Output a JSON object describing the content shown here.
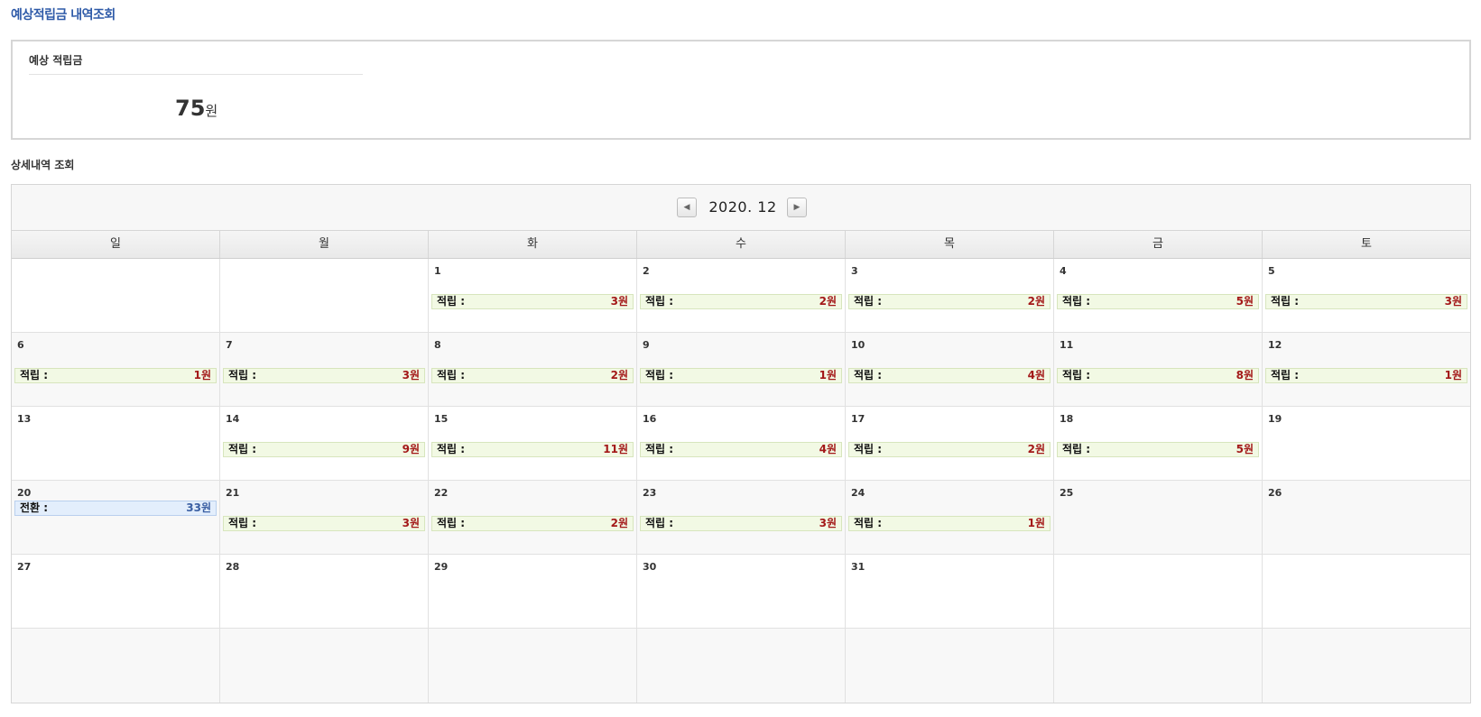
{
  "page": {
    "title": "예상적립금 내역조회"
  },
  "summary": {
    "label": "예상 적립금",
    "amount": "75",
    "unit": "원"
  },
  "details": {
    "title": "상세내역 조회"
  },
  "calendar": {
    "month_label": "2020. 12",
    "prev_icon": "triangle-left-icon",
    "next_icon": "triangle-right-icon",
    "weekdays": [
      "일",
      "월",
      "화",
      "수",
      "목",
      "금",
      "토"
    ],
    "weeks": [
      [
        {
          "day": "",
          "entries": []
        },
        {
          "day": "",
          "entries": []
        },
        {
          "day": "1",
          "entries": [
            {
              "type": "earn",
              "label": "적립 :",
              "amount": "3원"
            }
          ]
        },
        {
          "day": "2",
          "entries": [
            {
              "type": "earn",
              "label": "적립 :",
              "amount": "2원"
            }
          ]
        },
        {
          "day": "3",
          "entries": [
            {
              "type": "earn",
              "label": "적립 :",
              "amount": "2원"
            }
          ]
        },
        {
          "day": "4",
          "entries": [
            {
              "type": "earn",
              "label": "적립 :",
              "amount": "5원"
            }
          ]
        },
        {
          "day": "5",
          "entries": [
            {
              "type": "earn",
              "label": "적립 :",
              "amount": "3원"
            }
          ]
        }
      ],
      [
        {
          "day": "6",
          "entries": [
            {
              "type": "earn",
              "label": "적립 :",
              "amount": "1원"
            }
          ]
        },
        {
          "day": "7",
          "entries": [
            {
              "type": "earn",
              "label": "적립 :",
              "amount": "3원"
            }
          ]
        },
        {
          "day": "8",
          "entries": [
            {
              "type": "earn",
              "label": "적립 :",
              "amount": "2원"
            }
          ]
        },
        {
          "day": "9",
          "entries": [
            {
              "type": "earn",
              "label": "적립 :",
              "amount": "1원"
            }
          ]
        },
        {
          "day": "10",
          "entries": [
            {
              "type": "earn",
              "label": "적립 :",
              "amount": "4원"
            }
          ]
        },
        {
          "day": "11",
          "entries": [
            {
              "type": "earn",
              "label": "적립 :",
              "amount": "8원"
            }
          ]
        },
        {
          "day": "12",
          "entries": [
            {
              "type": "earn",
              "label": "적립 :",
              "amount": "1원"
            }
          ]
        }
      ],
      [
        {
          "day": "13",
          "entries": []
        },
        {
          "day": "14",
          "entries": [
            {
              "type": "earn",
              "label": "적립 :",
              "amount": "9원"
            }
          ]
        },
        {
          "day": "15",
          "entries": [
            {
              "type": "earn",
              "label": "적립 :",
              "amount": "11원"
            }
          ]
        },
        {
          "day": "16",
          "entries": [
            {
              "type": "earn",
              "label": "적립 :",
              "amount": "4원"
            }
          ]
        },
        {
          "day": "17",
          "entries": [
            {
              "type": "earn",
              "label": "적립 :",
              "amount": "2원"
            }
          ]
        },
        {
          "day": "18",
          "entries": [
            {
              "type": "earn",
              "label": "적립 :",
              "amount": "5원"
            }
          ]
        },
        {
          "day": "19",
          "entries": []
        }
      ],
      [
        {
          "day": "20",
          "entries": [
            {
              "type": "convert",
              "label": "전환 :",
              "amount": "33원"
            }
          ]
        },
        {
          "day": "21",
          "entries": [
            {
              "type": "earn",
              "label": "적립 :",
              "amount": "3원"
            }
          ]
        },
        {
          "day": "22",
          "entries": [
            {
              "type": "earn",
              "label": "적립 :",
              "amount": "2원"
            }
          ]
        },
        {
          "day": "23",
          "entries": [
            {
              "type": "earn",
              "label": "적립 :",
              "amount": "3원"
            }
          ]
        },
        {
          "day": "24",
          "entries": [
            {
              "type": "earn",
              "label": "적립 :",
              "amount": "1원"
            }
          ]
        },
        {
          "day": "25",
          "entries": []
        },
        {
          "day": "26",
          "entries": []
        }
      ],
      [
        {
          "day": "27",
          "entries": []
        },
        {
          "day": "28",
          "entries": []
        },
        {
          "day": "29",
          "entries": []
        },
        {
          "day": "30",
          "entries": []
        },
        {
          "day": "31",
          "entries": []
        },
        {
          "day": "",
          "entries": []
        },
        {
          "day": "",
          "entries": []
        }
      ],
      [
        {
          "day": "",
          "entries": []
        },
        {
          "day": "",
          "entries": []
        },
        {
          "day": "",
          "entries": []
        },
        {
          "day": "",
          "entries": []
        },
        {
          "day": "",
          "entries": []
        },
        {
          "day": "",
          "entries": []
        },
        {
          "day": "",
          "entries": []
        }
      ]
    ]
  },
  "colors": {
    "title_blue": "#2e5aa8",
    "earn_bg": "#f2f9e4",
    "earn_amount": "#a31818",
    "convert_bg": "#e3eefc",
    "convert_amount": "#3a5fa3"
  }
}
